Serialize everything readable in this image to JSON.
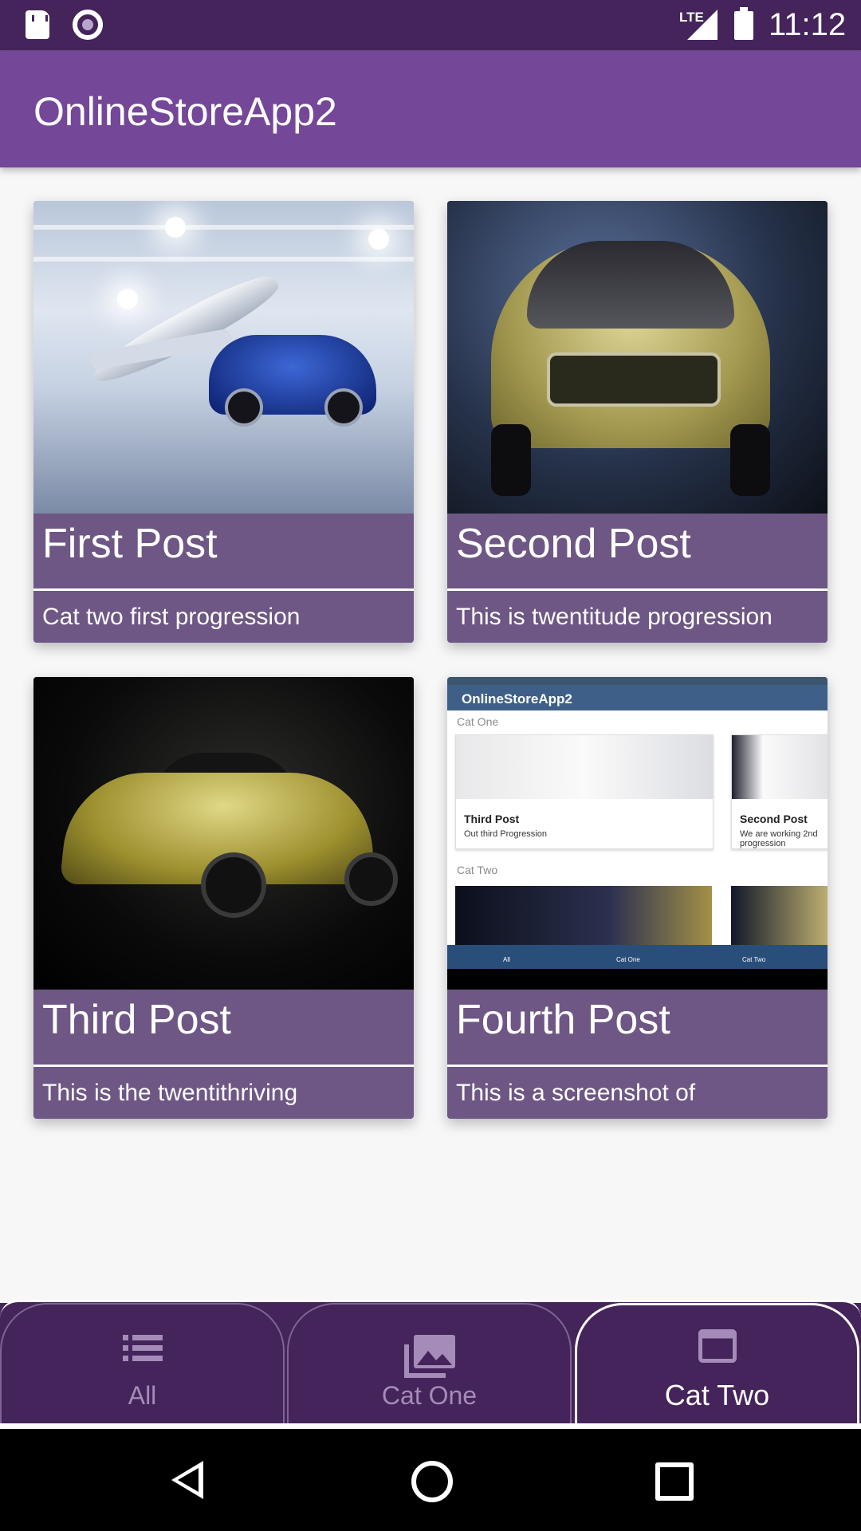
{
  "status_bar": {
    "time": "11:12",
    "network": "LTE"
  },
  "app_bar": {
    "title": "OnlineStoreApp2"
  },
  "posts": [
    {
      "title": "First Post",
      "description": "Cat two first progression",
      "image": "blue-car-with-plane-in-hangar"
    },
    {
      "title": "Second Post",
      "description": "This is twentitude progression",
      "image": "gold-suv-front"
    },
    {
      "title": "Third Post",
      "description": "This is the twentithriving",
      "image": "yellow-bmw-coupe"
    },
    {
      "title": "Fourth Post",
      "description": "This is a screenshot of",
      "image": "app-screenshot"
    }
  ],
  "screenshot_thumb": {
    "app_title": "OnlineStoreApp2",
    "section_one": "Cat One",
    "section_two": "Cat Two",
    "card_a_title": "Third Post",
    "card_a_sub": "Out third Progression",
    "card_b_title": "Second Post",
    "card_b_sub": "We are working 2nd progression",
    "nav_all": "All",
    "nav_cat_one": "Cat One",
    "nav_cat_two": "Cat Two"
  },
  "bottom_nav": {
    "tabs": [
      {
        "label": "All",
        "icon": "list-icon",
        "active": false
      },
      {
        "label": "Cat One",
        "icon": "photo-library-icon",
        "active": false
      },
      {
        "label": "Cat Two",
        "icon": "window-icon",
        "active": true
      }
    ]
  },
  "colors": {
    "status_bar": "#44245a",
    "app_bar": "#744798",
    "card_footer": "#6e5784",
    "bottom_nav": "#44245a"
  }
}
